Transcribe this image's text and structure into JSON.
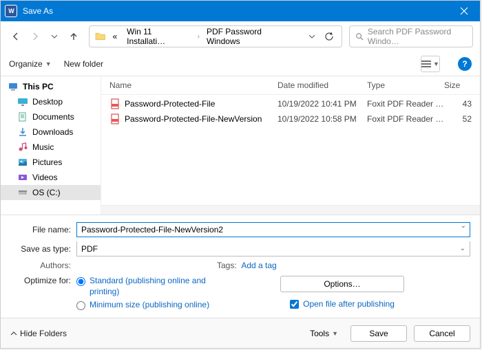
{
  "title": "Save As",
  "breadcrumbs": {
    "prefix": "«",
    "first": "Win 11 Installati…",
    "second": "PDF Password Windows"
  },
  "search_placeholder": "Search PDF Password Windo…",
  "toolbar": {
    "organize": "Organize",
    "new_folder": "New folder"
  },
  "sidebar": {
    "items": [
      {
        "label": "This PC"
      },
      {
        "label": "Desktop"
      },
      {
        "label": "Documents"
      },
      {
        "label": "Downloads"
      },
      {
        "label": "Music"
      },
      {
        "label": "Pictures"
      },
      {
        "label": "Videos"
      },
      {
        "label": "OS (C:)"
      }
    ]
  },
  "columns": {
    "name": "Name",
    "date": "Date modified",
    "type": "Type",
    "size": "Size"
  },
  "files": [
    {
      "name": "Password-Protected-File",
      "date": "10/19/2022 10:41 PM",
      "type": "Foxit PDF Reader …",
      "size": "43"
    },
    {
      "name": "Password-Protected-File-NewVersion",
      "date": "10/19/2022 10:58 PM",
      "type": "Foxit PDF Reader …",
      "size": "52"
    }
  ],
  "form": {
    "file_name_label": "File name:",
    "file_name_value": "Password-Protected-File-NewVersion2",
    "save_type_label": "Save as type:",
    "save_type_value": "PDF",
    "authors_label": "Authors:",
    "authors_value": "",
    "tags_label": "Tags:",
    "tags_link": "Add a tag",
    "optimize_label": "Optimize for:",
    "radio_standard": "Standard (publishing online and printing)",
    "radio_min": "Minimum size (publishing online)",
    "options_btn": "Options…",
    "open_after": "Open file after publishing"
  },
  "footer": {
    "hide": "Hide Folders",
    "tools": "Tools",
    "save": "Save",
    "cancel": "Cancel"
  }
}
